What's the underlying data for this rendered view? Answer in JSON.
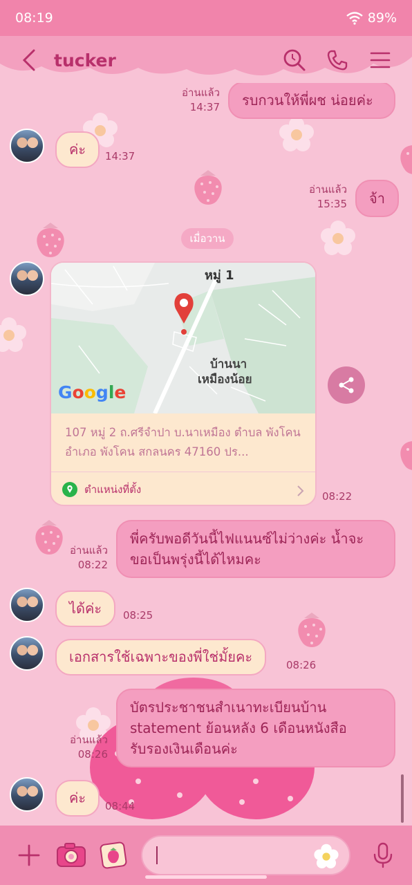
{
  "status_bar": {
    "time": "08:19",
    "battery": "89%"
  },
  "header": {
    "title": "tucker"
  },
  "messages": [
    {
      "text": "รบกวนให้พี่ผช น่อยค่ะ",
      "status": "อ่านแล้ว",
      "time": "14:37"
    },
    {
      "text": "ค่ะ",
      "time": "14:37"
    },
    {
      "text": "จ้า",
      "status": "อ่านแล้ว",
      "time": "15:35"
    },
    {
      "text": "พี่ครับพอดีวันนี้ไฟแนนซ์ไม่ว่างค่ะ น้ำจะ\nขอเป็นพรุ่งนี้ได้ไหมคะ",
      "status": "อ่านแล้ว",
      "time": "08:22"
    },
    {
      "text": "ได้ค่ะ",
      "time": "08:25"
    },
    {
      "text": "เอกสารใช้เฉพาะของพี่ใช่มั้ยคะ",
      "time": "08:26"
    },
    {
      "text": "บัตรประชาชนสำเนาทะเบียนบ้าน\nstatement ย้อนหลัง 6 เดือนหนังสือ\nรับรองเงินเดือนค่ะ",
      "status": "อ่านแล้ว",
      "time": "08:26"
    },
    {
      "text": "ค่ะ",
      "time": "08:44"
    }
  ],
  "date_separator": "เมื่อวาน",
  "location": {
    "map_label_1": "หมู่ 1",
    "map_label_2": "บ้านนา\nเหมืองน้อย",
    "map_brand": "Google",
    "address": "107 หมู่ 2 ถ.ศรีจำปา บ.นาเหมือง ตำบล พังโคน อำเภอ พังโคน สกลนคร 47160 ปร...",
    "footer_label": "ตำแหน่งที่ตั้ง",
    "time": "08:22"
  },
  "input": {
    "placeholder": ""
  },
  "icons": [
    "back-icon",
    "search-icon",
    "phone-icon",
    "menu-icon",
    "share-icon",
    "plus-icon",
    "camera-icon",
    "gallery-icon",
    "sticker-icon",
    "mic-icon",
    "location-pin-icon",
    "chevron-right-icon",
    "wifi-icon",
    "battery-icon"
  ],
  "colors": {
    "accent": "#b8306b",
    "background": "#f8c3d6",
    "bubble_in": "#fde8cf",
    "bubble_out": "#f49ec0"
  }
}
